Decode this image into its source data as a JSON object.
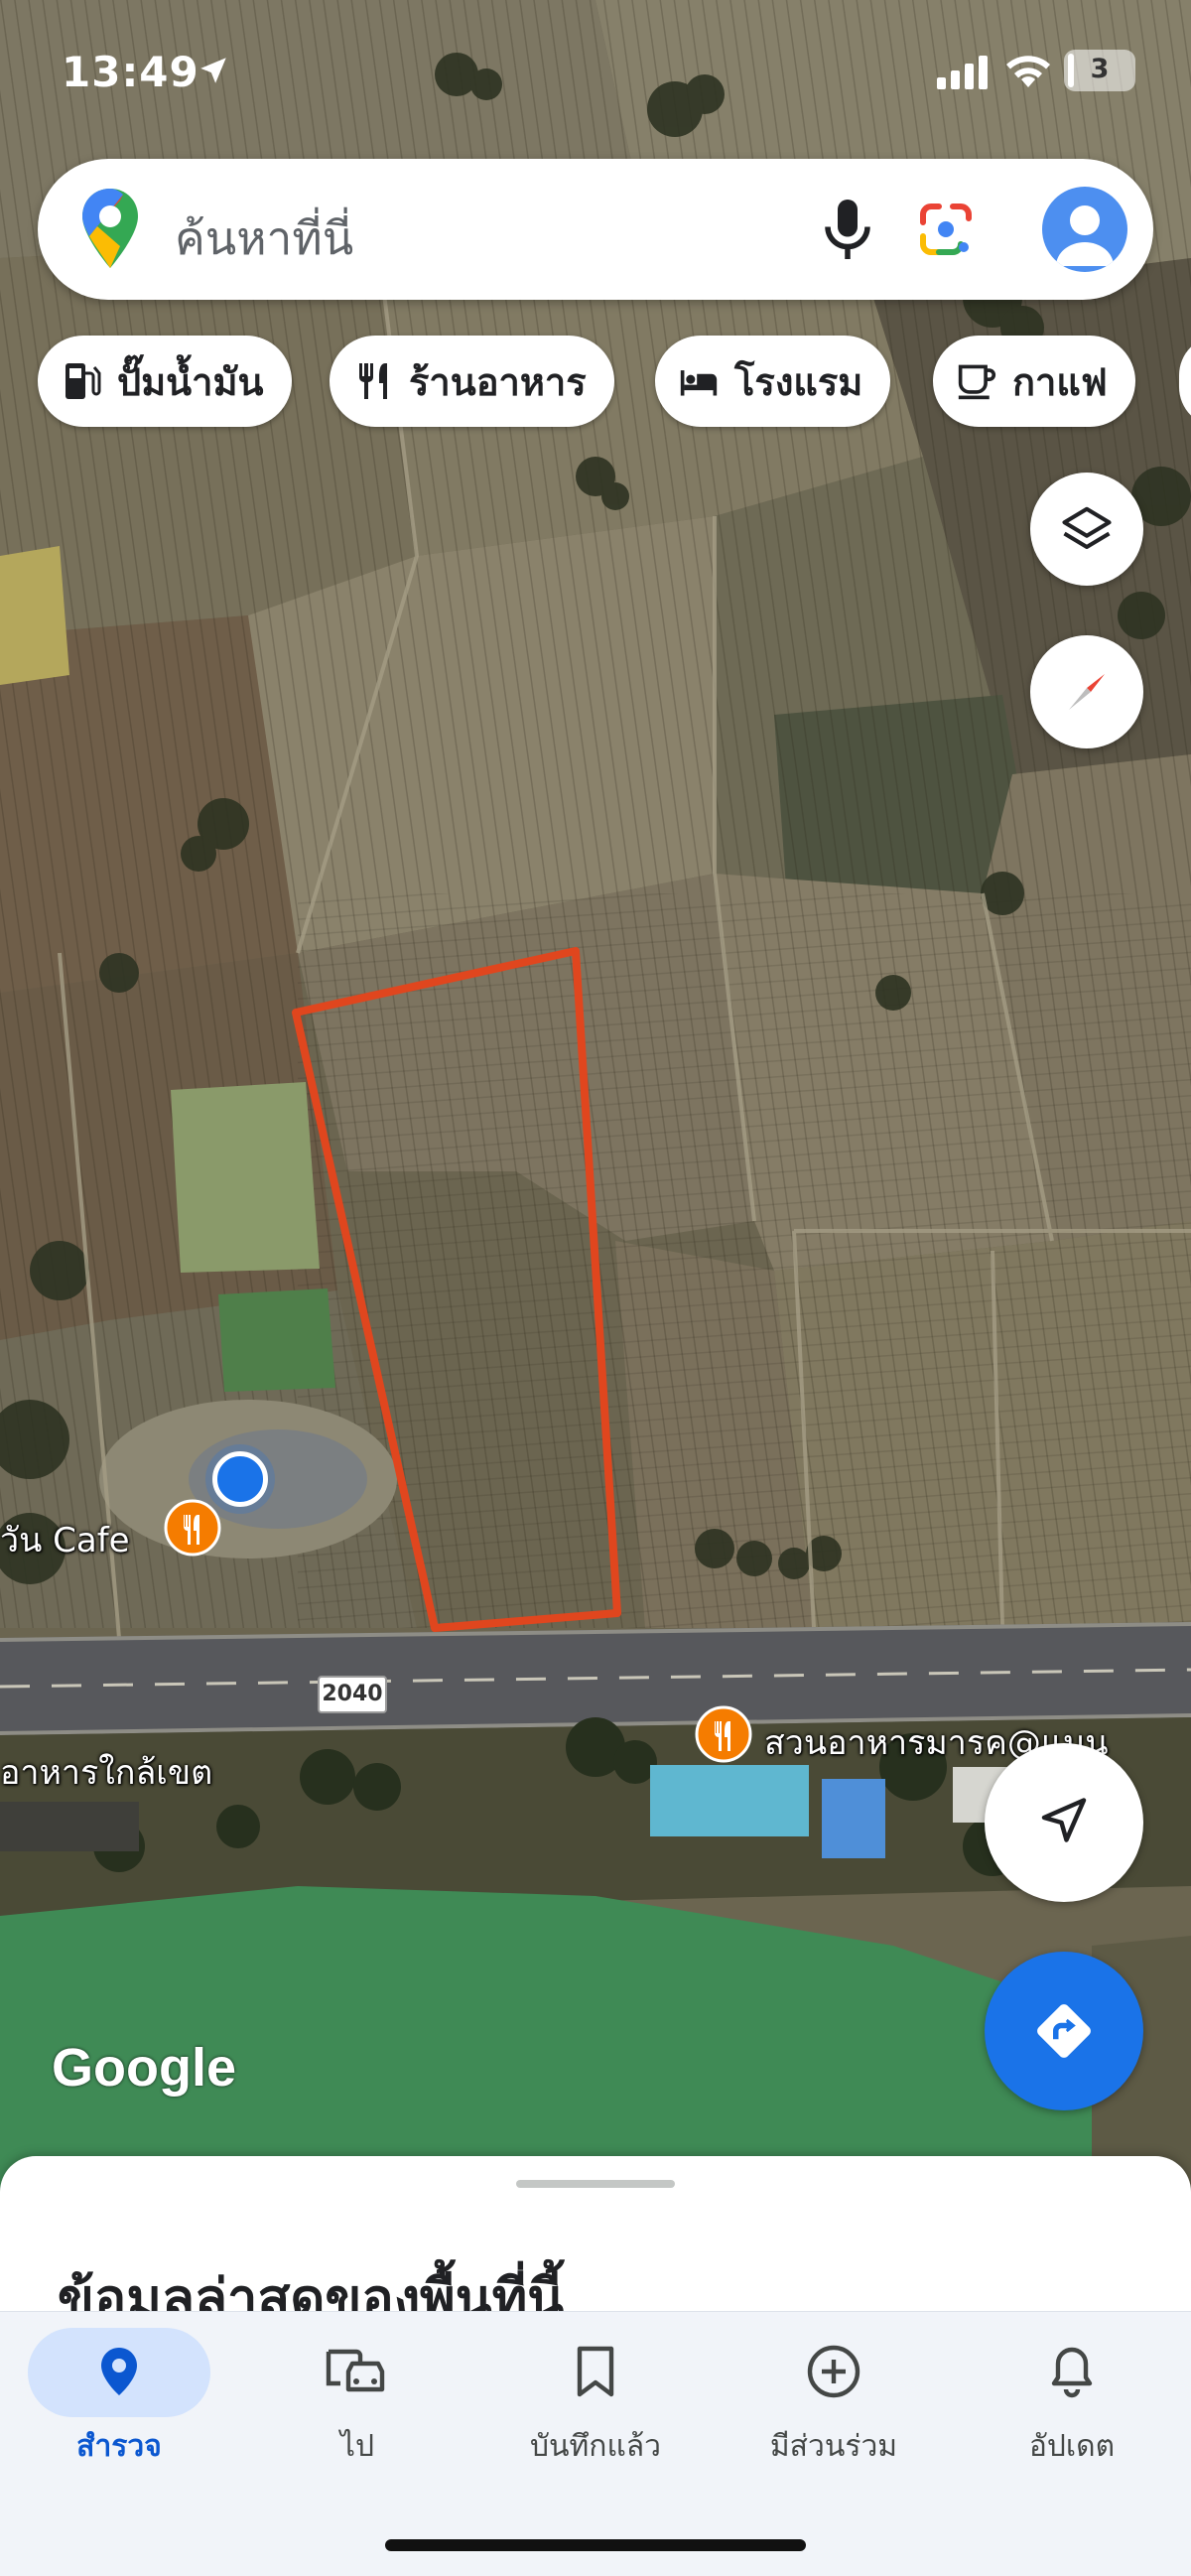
{
  "status_bar": {
    "time": "13:49",
    "battery": "3"
  },
  "search": {
    "placeholder": "ค้นหาที่นี่"
  },
  "chips": [
    {
      "label": "ปั๊มน้ำมัน",
      "icon": "gas-station-icon"
    },
    {
      "label": "ร้านอาหาร",
      "icon": "restaurant-icon"
    },
    {
      "label": "โรงแรม",
      "icon": "hotel-icon"
    },
    {
      "label": "กาแฟ",
      "icon": "coffee-icon"
    }
  ],
  "map": {
    "road_number": "2040",
    "places": [
      {
        "name": "วัน Cafe",
        "icon": "restaurant-pin-icon"
      },
      {
        "name": "สวนอาหารมารค@แมน",
        "icon": "restaurant-pin-icon"
      }
    ],
    "road_label": "อาหารใกล้เขต",
    "attribution": "Google",
    "colors": {
      "parcel_outline": "#e0461e",
      "location_dot": "#1a73e8",
      "pin": "#f57c00",
      "directions_fab": "#1a73e8"
    }
  },
  "sheet": {
    "title": "ข้อมูลล่าสุดของพื้นที่นี้"
  },
  "nav": [
    {
      "label": "สำรวจ",
      "icon": "explore-pin-icon",
      "active": true
    },
    {
      "label": "ไป",
      "icon": "commute-icon",
      "active": false
    },
    {
      "label": "บันทึกแล้ว",
      "icon": "bookmark-icon",
      "active": false
    },
    {
      "label": "มีส่วนร่วม",
      "icon": "add-circle-icon",
      "active": false
    },
    {
      "label": "อัปเดต",
      "icon": "bell-icon",
      "active": false
    }
  ]
}
